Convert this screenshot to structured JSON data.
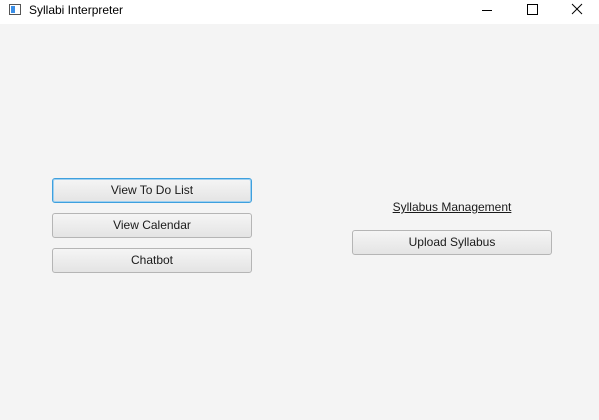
{
  "window": {
    "title": "Syllabi Interpreter",
    "icon": "app-window-icon",
    "controls": {
      "minimize_icon": "minimize-icon",
      "maximize_icon": "maximize-icon",
      "close_icon": "close-icon"
    }
  },
  "left_panel": {
    "view_todo_label": "View To Do List",
    "view_calendar_label": "View Calendar",
    "chatbot_label": "Chatbot"
  },
  "right_panel": {
    "heading": "Syllabus Management",
    "upload_label": "Upload Syllabus"
  },
  "colors": {
    "background": "#f4f4f4",
    "focus_accent": "#3ea0de"
  }
}
